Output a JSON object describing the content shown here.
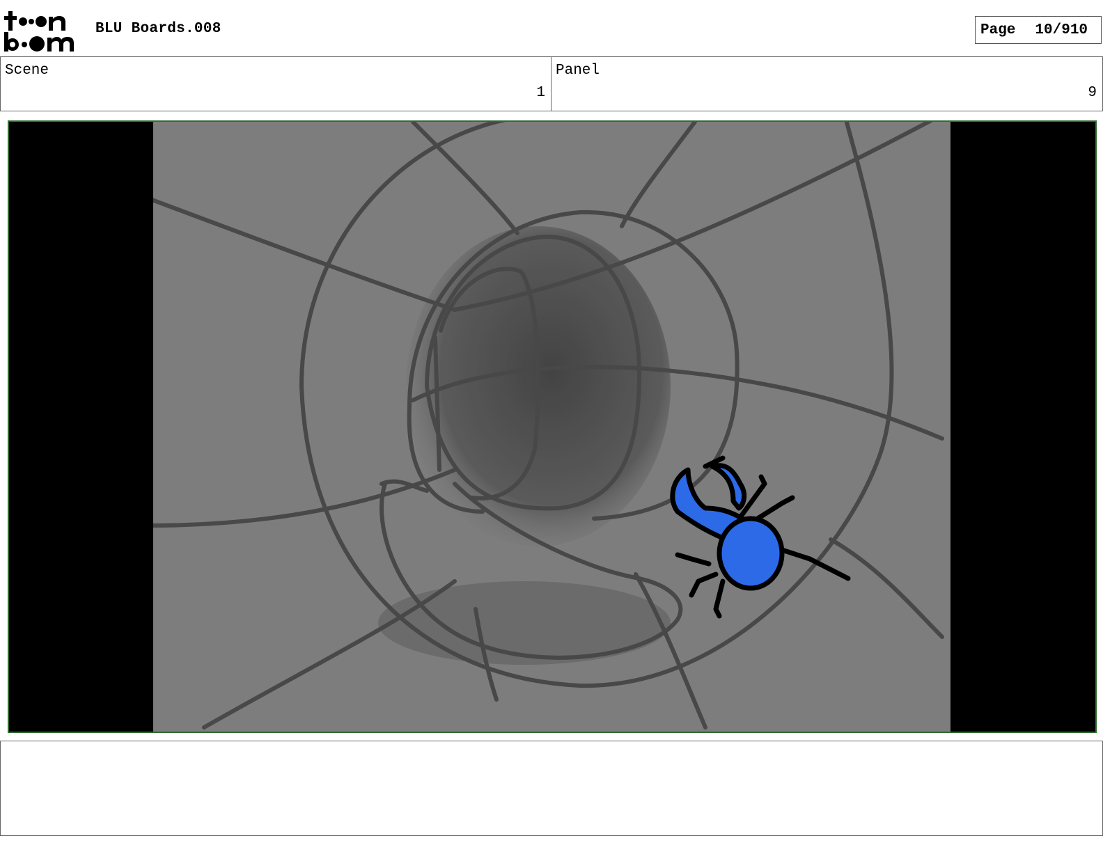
{
  "header": {
    "logo_text": "toonboom",
    "document_title": "BLU Boards.008",
    "page_label": "Page",
    "page_value": "10/910"
  },
  "info": {
    "scene_label": "Scene",
    "scene_value": "1",
    "panel_label": "Panel",
    "panel_value": "9"
  },
  "frame": {
    "border_color": "#2f6b2f",
    "background_gray": "#7d7d7d",
    "beetle_color": "#2d6ae8"
  },
  "notes": {
    "text": ""
  }
}
